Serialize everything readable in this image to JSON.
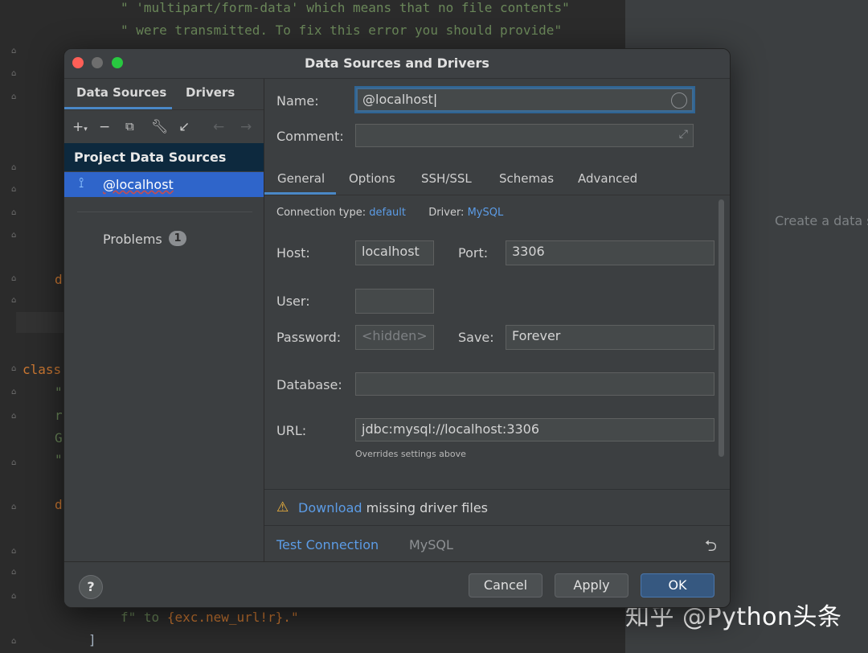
{
  "editor": {
    "line1": "\" 'multipart/form-data' which means that no file contents\"",
    "line2": "\" were transmitted. To fix this error you should provide\"",
    "frag_d1": "d",
    "frag_class": "class",
    "frag_q1": "\"",
    "frag_r": "r",
    "frag_g": "G",
    "frag_q2": "\"",
    "frag_d2": "d",
    "bottom_f": "f\"",
    "bottom_to": "to",
    "bottom_expr": "{exc.new_url!r}.\"",
    "bottom_bracket": "]"
  },
  "right_panel": {
    "hint": "Create a data s"
  },
  "watermark": "知乎 @Python头条",
  "dialog": {
    "title": "Data Sources and Drivers",
    "left_tabs": [
      "Data Sources",
      "Drivers"
    ],
    "toolbar_icons": [
      "add-icon",
      "remove-icon",
      "duplicate-icon",
      "wrench-icon",
      "import-icon",
      "back-arrow-icon",
      "forward-arrow-icon"
    ],
    "group_header": "Project Data Sources",
    "selected_source": "@localhost",
    "problems_label": "Problems",
    "problems_count": "1",
    "name_label": "Name:",
    "name_value": "@localhost",
    "comment_label": "Comment:",
    "comment_value": "",
    "tabs": [
      "General",
      "Options",
      "SSH/SSL",
      "Schemas",
      "Advanced"
    ],
    "active_tab": "General",
    "general": {
      "conn_type_label": "Connection type:",
      "conn_type_value": "default",
      "driver_label": "Driver:",
      "driver_value": "MySQL",
      "host_label": "Host:",
      "host_value": "localhost",
      "port_label": "Port:",
      "port_value": "3306",
      "user_label": "User:",
      "user_value": "",
      "password_label": "Password:",
      "password_placeholder": "<hidden>",
      "save_label": "Save:",
      "save_value": "Forever",
      "database_label": "Database:",
      "database_value": "",
      "url_label": "URL:",
      "url_value": "jdbc:mysql://localhost:3306",
      "overrides_note": "Overrides settings above"
    },
    "warning_link": "Download",
    "warning_text": " missing driver files",
    "test_connection": "Test Connection",
    "driver_footer": "MySQL",
    "help": "?",
    "cancel": "Cancel",
    "apply": "Apply",
    "ok": "OK"
  },
  "colors": {
    "accent": "#4a88c7",
    "selection": "#2f65ca",
    "link": "#5c9ce6",
    "warning": "#f2b43c",
    "close": "#ff5f57",
    "minimize": "#6e6e6e",
    "maximize": "#28c840"
  }
}
